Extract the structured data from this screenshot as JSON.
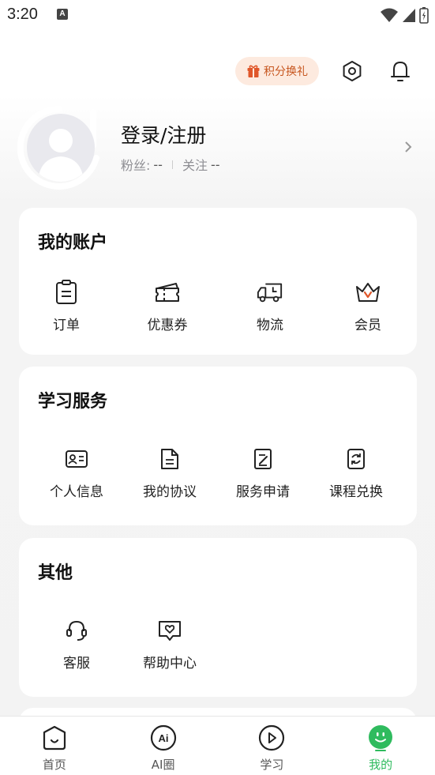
{
  "status_bar": {
    "time": "3:20",
    "notif_letter": "A"
  },
  "top_actions": {
    "points_label": "积分换礼"
  },
  "profile": {
    "username": "登录/注册",
    "followers_label": "粉丝:",
    "followers_value": "--",
    "following_label": "关注",
    "following_value": "--"
  },
  "account": {
    "title": "我的账户",
    "items": [
      {
        "label": "订单",
        "icon": "clipboard-icon"
      },
      {
        "label": "优惠券",
        "icon": "coupon-icon"
      },
      {
        "label": "物流",
        "icon": "truck-icon"
      },
      {
        "label": "会员",
        "icon": "crown-icon"
      }
    ]
  },
  "learning": {
    "title": "学习服务",
    "items": [
      {
        "label": "个人信息",
        "icon": "id-card-icon"
      },
      {
        "label": "我的协议",
        "icon": "document-icon"
      },
      {
        "label": "服务申请",
        "icon": "edit-document-icon"
      },
      {
        "label": "课程兑换",
        "icon": "exchange-icon"
      }
    ]
  },
  "other": {
    "title": "其他",
    "items": [
      {
        "label": "客服",
        "icon": "headset-icon"
      },
      {
        "label": "帮助中心",
        "icon": "help-chat-icon"
      }
    ]
  },
  "bottom_nav": {
    "items": [
      {
        "label": "首页",
        "icon": "home-icon"
      },
      {
        "label": "AI圈",
        "icon": "ai-icon"
      },
      {
        "label": "学习",
        "icon": "play-icon"
      },
      {
        "label": "我的",
        "icon": "smile-icon"
      }
    ],
    "active_index": 3
  },
  "colors": {
    "accent_green": "#2fbb5e",
    "points_orange": "#c7561f",
    "points_bg": "#fdeadf"
  }
}
